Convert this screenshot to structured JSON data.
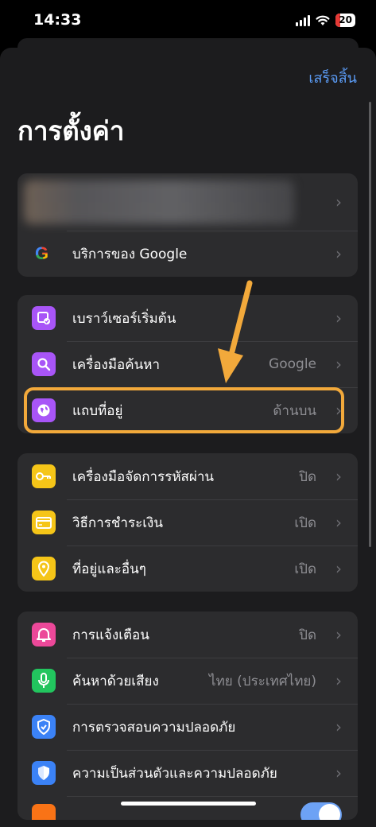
{
  "status_bar": {
    "time": "14:33",
    "battery": "20"
  },
  "header": {
    "done_label": "เสร็จสิ้น",
    "title": "การตั้งค่า"
  },
  "account_group": {
    "google_services_label": "บริการของ Google"
  },
  "browser_group": [
    {
      "label": "เบราว์เซอร์เริ่มต้น",
      "value": "",
      "icon": "browser-default-icon",
      "color": "#a855f7"
    },
    {
      "label": "เครื่องมือค้นหา",
      "value": "Google",
      "icon": "search-icon",
      "color": "#a855f7"
    },
    {
      "label": "แถบที่อยู่",
      "value": "ด้านบน",
      "icon": "globe-icon",
      "color": "#a855f7"
    }
  ],
  "autofill_group": [
    {
      "label": "เครื่องมือจัดการรหัสผ่าน",
      "value": "ปิด",
      "icon": "key-icon",
      "color": "#f5c518"
    },
    {
      "label": "วิธีการชำระเงิน",
      "value": "เปิด",
      "icon": "credit-card-icon",
      "color": "#f5c518"
    },
    {
      "label": "ที่อยู่และอื่นๆ",
      "value": "เปิด",
      "icon": "location-pin-icon",
      "color": "#f5c518"
    }
  ],
  "privacy_group": [
    {
      "label": "การแจ้งเตือน",
      "value": "ปิด",
      "icon": "bell-icon",
      "color": "#ec4899"
    },
    {
      "label": "ค้นหาด้วยเสียง",
      "value": "ไทย (ประเทศไทย)",
      "icon": "microphone-icon",
      "color": "#22c55e"
    },
    {
      "label": "การตรวจสอบความปลอดภัย",
      "value": "",
      "icon": "shield-check-icon",
      "color": "#3b82f6"
    },
    {
      "label": "ความเป็นส่วนตัวและความปลอดภัย",
      "value": "",
      "icon": "shield-icon",
      "color": "#3b82f6"
    }
  ],
  "accent_colors": {
    "highlight": "#f2a93b",
    "link": "#5b9cf6"
  }
}
